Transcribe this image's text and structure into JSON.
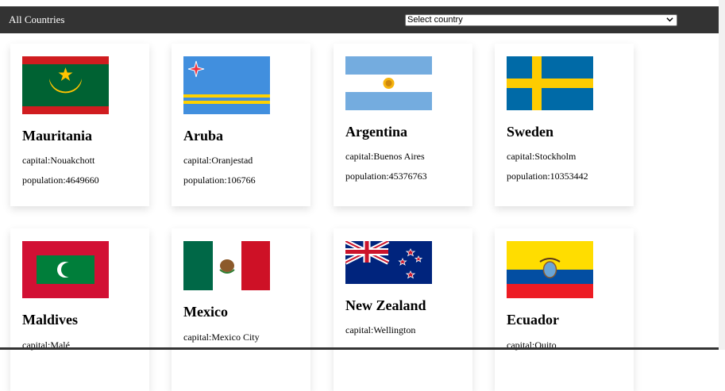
{
  "navbar": {
    "title": "All Countries",
    "select_value": "Select country"
  },
  "countries": [
    {
      "name": "Mauritania",
      "capital_label": "capital:Nouakchott",
      "population_label": "population:4649660",
      "flag": "mauritania-flag-icon"
    },
    {
      "name": "Aruba",
      "capital_label": "capital:Oranjestad",
      "population_label": "population:106766",
      "flag": "aruba-flag-icon"
    },
    {
      "name": "Argentina",
      "capital_label": "capital:Buenos Aires",
      "population_label": "population:45376763",
      "flag": "argentina-flag-icon"
    },
    {
      "name": "Sweden",
      "capital_label": "capital:Stockholm",
      "population_label": "population:10353442",
      "flag": "sweden-flag-icon"
    },
    {
      "name": "Maldives",
      "capital_label": "capital:Malé",
      "population_label": "",
      "flag": "maldives-flag-icon"
    },
    {
      "name": "Mexico",
      "capital_label": "capital:Mexico City",
      "population_label": "",
      "flag": "mexico-flag-icon"
    },
    {
      "name": "New Zealand",
      "capital_label": "capital:Wellington",
      "population_label": "",
      "flag": "new-zealand-flag-icon"
    },
    {
      "name": "Ecuador",
      "capital_label": "capital:Quito",
      "population_label": "",
      "flag": "ecuador-flag-icon"
    }
  ],
  "colors": {
    "navbar_bg": "#333333",
    "card_bg": "#ffffff"
  }
}
